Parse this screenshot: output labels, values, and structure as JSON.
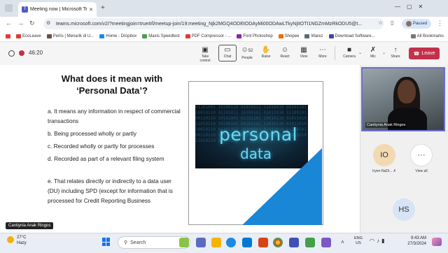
{
  "browser": {
    "tab_title": "Meeting now | Microsoft Te",
    "url": "teams.microsoft.com/v2/?meetingjoin=true#/l/meetup-join/19:meeting_Njk2MGQ4ODEtODAyMi00ODAwLTkyNjItOTI1NGZmMzRkODU5@t...",
    "paused_label": "Paused",
    "new_tab": "+",
    "bookmarks": [
      {
        "label": "EcoLeave",
        "color": "#e53935"
      },
      {
        "label": "Perlis | Menarik di U...",
        "color": "#6d4c41"
      },
      {
        "label": "Home - Dropbox",
        "color": "#1e88e5"
      },
      {
        "label": "Maxis Speedtest",
        "color": "#43a047"
      },
      {
        "label": "PDF Compressor - ...",
        "color": "#e53935"
      },
      {
        "label": "Font Photoshop",
        "color": "#8e24aa"
      },
      {
        "label": "Shopee",
        "color": "#ef6c00"
      },
      {
        "label": "Warez",
        "color": "#546e7a"
      },
      {
        "label": "Download Software...",
        "color": "#3949ab"
      }
    ],
    "all_bookmarks": "All Bookmarks"
  },
  "teams": {
    "timer": "46:20",
    "toolbar": [
      {
        "label": "Take control",
        "icon": "take-control-icon",
        "glyph": "▣"
      },
      {
        "label": "Chat",
        "icon": "chat-icon",
        "glyph": "▭"
      },
      {
        "label": "People",
        "icon": "people-icon",
        "glyph": "☺",
        "count": "52"
      },
      {
        "label": "Raise",
        "icon": "raise-hand-icon",
        "glyph": "✋"
      },
      {
        "label": "React",
        "icon": "react-icon",
        "glyph": "☺"
      },
      {
        "label": "View",
        "icon": "view-icon",
        "glyph": "▦"
      },
      {
        "label": "More",
        "icon": "more-icon",
        "glyph": "⋯"
      }
    ],
    "av": [
      {
        "label": "Camera",
        "icon": "camera-icon",
        "glyph": "■"
      },
      {
        "label": "Mic",
        "icon": "mic-icon",
        "glyph": "✗"
      },
      {
        "label": "Share",
        "icon": "share-icon",
        "glyph": "↑"
      }
    ],
    "leave_label": "Leave",
    "presenter_name": "Cantiynia Anak Ringos",
    "video_name": "Cantiynia Anak Ringos",
    "participants": [
      {
        "initials": "IO",
        "name": "Iryen-NaDi...",
        "color": "#f3d9b1"
      },
      {
        "initials": "···",
        "name": "View all",
        "color": "#ffffff"
      },
      {
        "initials": "HS",
        "name": "",
        "color": "#d6e4f5"
      }
    ]
  },
  "slide": {
    "title_line1": "What does it mean with",
    "title_line2": "‘Personal Data’?",
    "items": [
      "a. It means any information in respect of commercial transactions",
      "b. Being processed wholly or partly",
      "c. Recorded wholly or partly for processes",
      "d. Recorded as part of a relevant filing system",
      "e. That relates directly or indirectly to a data user (DU) including SPD (except for information that is processed for Credit Reporting Business"
    ],
    "image_word1": "personal",
    "image_word2": "data",
    "image_bits": "01101001 10100110 01010111 11010010 00101101 10010110 01101011 10100101 01011010 11100101 00110110 10101001 01101101 10010110 01011010 11010110 10100101 00101101 11010110 01011010 10010110 01101011 10100101 01011010 11100101 00110110 10101001 01101101 10010110 01011010 11010110 10100101"
  },
  "taskbar": {
    "weather_temp": "27°C",
    "weather_desc": "Hazy",
    "search_label": "Search",
    "lang1": "ENG",
    "lang2": "US",
    "time": "9:43 AM",
    "date": "27/3/2024"
  }
}
